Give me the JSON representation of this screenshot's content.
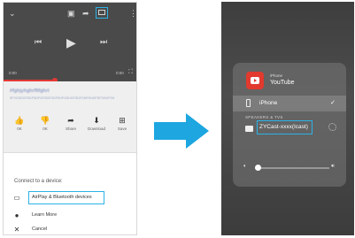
{
  "left_phone": {
    "player": {
      "time_current": "0:00",
      "time_total": "0:00",
      "progress_fraction": 0.38
    },
    "video": {
      "title": "#fghjyhghrfftfghrt",
      "subtitle": "SFVGSDGFSDFSDFGFSDFGDFSHFGSHGFSDFGNFSHGFDFSHGFSH"
    },
    "actions": [
      {
        "icon": "thumbs-up-icon",
        "glyph": "👍",
        "label": "0K"
      },
      {
        "icon": "thumbs-down-icon",
        "glyph": "👎",
        "label": "0K"
      },
      {
        "icon": "share-icon",
        "glyph": "➦",
        "label": "Share"
      },
      {
        "icon": "download-icon",
        "glyph": "⬇",
        "label": "Download"
      },
      {
        "icon": "save-icon",
        "glyph": "⊞",
        "label": "Save"
      }
    ],
    "sheet": {
      "title": "Connect to a device:",
      "options": [
        {
          "icon": "tv-icon",
          "glyph": "▭",
          "label": "AirPlay & Bluetooth devices"
        },
        {
          "icon": "info-icon",
          "glyph": "●",
          "label": "Learn More"
        },
        {
          "icon": "close-icon",
          "glyph": "✕",
          "label": "Cancel"
        }
      ]
    }
  },
  "right_phone": {
    "now_playing": {
      "device": "iPhone",
      "app": "YouTube"
    },
    "devices": [
      {
        "name": "iPhone",
        "selected": true
      }
    ],
    "speakers_header": "SPEAKERS & TVS",
    "cast_device": "ZYCast-xxxx(Icast)",
    "volume_fraction": 0.05
  },
  "colors": {
    "highlight": "#2bb3e6",
    "arrow": "#1da6e0",
    "youtube_red": "#e23a2e",
    "progress_red": "#e53935"
  }
}
